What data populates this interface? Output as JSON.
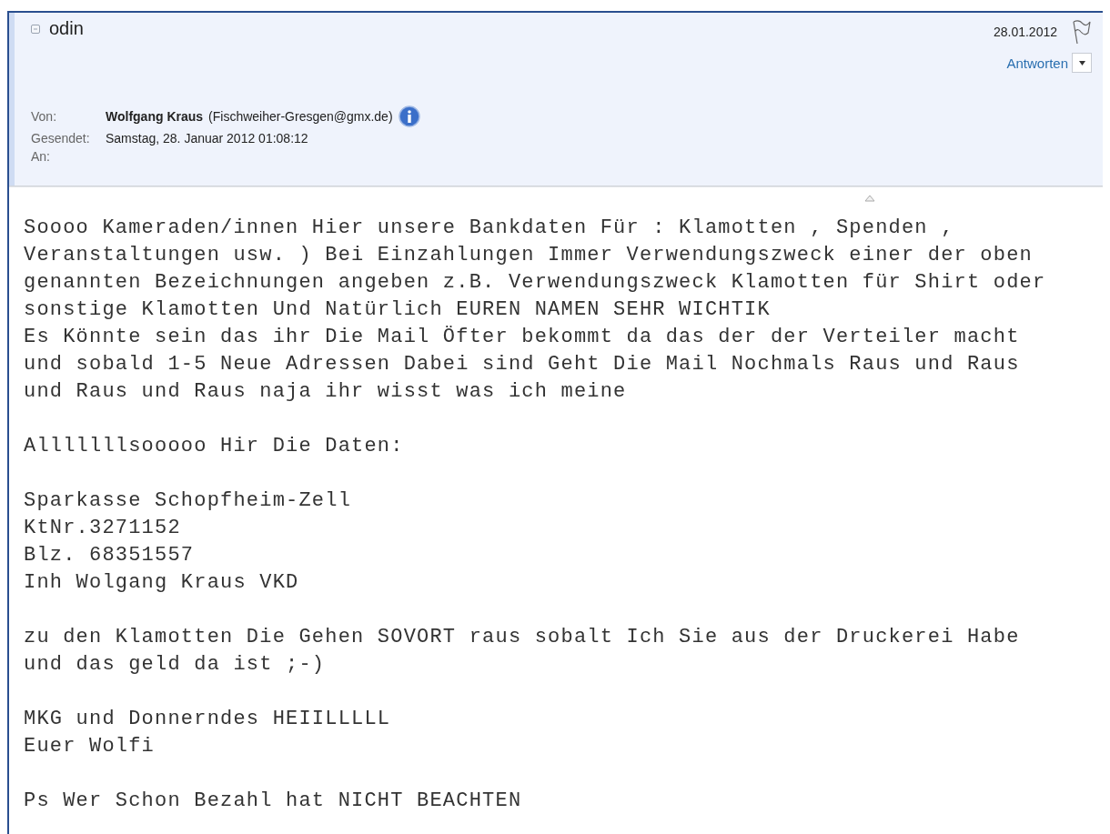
{
  "message": {
    "subject": "odin",
    "date": "28.01.2012",
    "reply_button": "Antworten",
    "from": {
      "label": "Von:",
      "name": "Wolfgang Kraus",
      "address": "(Fischweiher-Gresgen@gmx.de)"
    },
    "sent": {
      "label": "Gesendet:",
      "value": "Samstag, 28. Januar 2012 01:08:12"
    },
    "to": {
      "label": "An:"
    }
  },
  "body": {
    "paragraphs": [
      [
        "Soooo Kameraden/innen Hier unsere Bankdaten Für : Klamotten , Spenden ,",
        "Veranstaltungen usw. ) Bei Einzahlungen Immer Verwendungszweck einer der oben",
        "genannten Bezeichnungen angeben z.B. Verwendungszweck Klamotten für Shirt oder",
        "sonstige Klamotten Und Natürlich EUREN NAMEN SEHR WICHTIK",
        "Es Könnte sein das ihr Die Mail Öfter bekommt da das der der Verteiler macht",
        "und sobald 1-5 Neue Adressen Dabei sind Geht Die Mail Nochmals Raus und Raus",
        "und Raus und Raus naja ihr wisst was ich meine"
      ],
      [
        "Alllllllsooooo Hir Die Daten:"
      ],
      [
        "Sparkasse Schopfheim-Zell",
        "KtNr.3271152",
        "Blz. 68351557",
        "Inh Wolgang Kraus VKD"
      ],
      [
        "zu den Klamotten Die Gehen SOVORT raus sobalt Ich Sie aus der Druckerei Habe",
        "und das geld da ist ;-)"
      ],
      [
        "MKG und Donnerndes HEIILLLLL",
        "Euer Wolfi"
      ],
      [
        "Ps Wer Schon Bezahl hat NICHT BEACHTEN"
      ]
    ]
  }
}
